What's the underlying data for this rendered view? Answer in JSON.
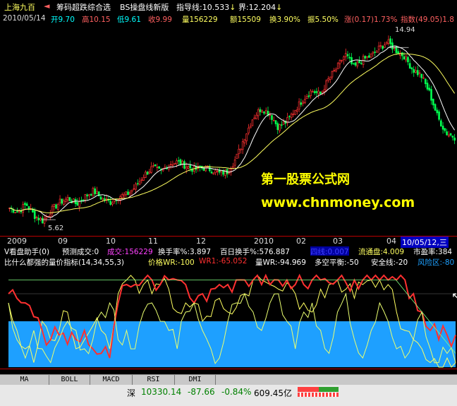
{
  "header": {
    "stock_name": "上海九百",
    "formula_name": "筹码超跌综合选",
    "bs_name": "BS操盘线新版",
    "guide_label": "指导线:",
    "guide_value": "10.533",
    "bound_label": "界:",
    "bound_value": "12.204",
    "arrow_down": "↓"
  },
  "quote": {
    "date": "2010/05/14",
    "open": "开9.70",
    "high": "高10.15",
    "low": "低9.61",
    "close": "收9.99",
    "volume": "量156229",
    "amount": "额15509",
    "turnover": "换3.90%",
    "amplitude": "振5.50%",
    "change": "涨(0.17)1.73%",
    "index": "指数(49.05)1.8"
  },
  "price_labels": {
    "high_mark": "14.94",
    "low_mark": "5.62"
  },
  "date_axis": [
    "2009",
    "09",
    "10",
    "11",
    "12",
    "2010",
    "02",
    "03",
    "04",
    "10/05/12,三"
  ],
  "panel1": {
    "name": "V看盘助手(0)",
    "predict": "预测成交:0",
    "volume": "成交:156229",
    "turnover_rate": "换手率%:3.897",
    "hundred_turnover": "百日换手%:576.887",
    "hidden": "四线:0.007",
    "float_cap": "流通盘:4.009",
    "pe": "市盈率:384"
  },
  "panel2": {
    "name": "比什么都强的量价指标(14,34,55,3)",
    "price_wr": "价格WR:-100",
    "wr1": "WR1:-65.052",
    "vol_wr": "量WR:-94.969",
    "balance": "多空平衡:-50",
    "safety": "安全线:-20",
    "risk": "风险区:-80"
  },
  "watermark": {
    "line1": "第一股票公式网",
    "line2": "www.chnmoney.com"
  },
  "tabs": [
    "MA",
    "BOLL",
    "MACD",
    "RSI",
    "DMI"
  ],
  "status": {
    "market": "深",
    "index_value": "10330.14",
    "change": "-87.66",
    "change_pct": "-0.84%",
    "amount": "609.45亿"
  },
  "colors": {
    "up": "#ff3030",
    "down": "#00ff50",
    "ma_yellow": "#ffff60",
    "ma_white": "#ffffff",
    "blue_band": "#1ea0ff",
    "cyan": "#00ffff",
    "magenta": "#ff40ff"
  },
  "chart_data": [
    {
      "type": "candlestick",
      "title": "上海九百",
      "x_range": [
        "2009-07",
        "2010-05-14"
      ],
      "ylim": [
        5.0,
        15.5
      ],
      "key_prices": {
        "low": 5.62,
        "high": 14.94,
        "last_close": 9.99
      },
      "price_path": [
        6.3,
        6.1,
        6.5,
        5.9,
        5.62,
        6.2,
        6.6,
        6.8,
        6.5,
        6.9,
        7.2,
        6.8,
        6.6,
        6.9,
        7.0,
        7.4,
        8.0,
        8.4,
        8.2,
        8.6,
        8.7,
        8.5,
        8.3,
        8.4,
        8.3,
        8.1,
        8.2,
        8.9,
        10.0,
        11.0,
        11.5,
        11.2,
        10.5,
        10.8,
        11.4,
        12.0,
        12.4,
        12.2,
        13.0,
        13.6,
        14.3,
        13.6,
        14.0,
        14.2,
        14.6,
        14.94,
        14.5,
        14.2,
        13.5,
        13.2,
        12.3,
        11.0,
        10.2,
        9.99
      ]
    },
    {
      "type": "line",
      "title": "比什么都强的量价指标",
      "ylim": [
        -100,
        0
      ],
      "series": [
        {
          "name": "价格WR",
          "values": [
            -30,
            -60,
            -80,
            -95,
            -50,
            -70,
            -60,
            -40,
            -80,
            -70,
            -55,
            -60,
            -80,
            -20,
            -5,
            -5,
            -10,
            -20,
            -10,
            -15,
            -40,
            -30,
            -30,
            -50,
            -45,
            -25,
            -40,
            -35,
            -20,
            -5,
            -5,
            -10,
            -15,
            -8,
            -20,
            -30,
            -40,
            -15,
            -10,
            -5,
            -15,
            -25,
            -10,
            -5,
            -5,
            -10,
            -40,
            -60,
            -70,
            -80,
            -95,
            -100,
            -90,
            -95
          ]
        },
        {
          "name": "WR1",
          "values": [
            -20,
            -25,
            -30,
            -45,
            -60,
            -70,
            -65,
            -75,
            -70,
            -60,
            -80,
            -85,
            -90,
            -30,
            -10,
            -10,
            -5,
            -5,
            -10,
            -5,
            -5,
            -10,
            -30,
            -20,
            -15,
            -10,
            -10,
            -5,
            -5,
            -5,
            -10,
            -10,
            -5,
            -5,
            -10,
            -10,
            -5,
            -5,
            -8,
            -5,
            -8,
            -5,
            -5,
            -5,
            -5,
            -5,
            -5,
            -5,
            -20,
            -40,
            -60,
            -70,
            -65,
            -65
          ]
        },
        {
          "name": "量WR",
          "values": [
            -30,
            -70,
            -90,
            -60,
            -80,
            -95,
            -70,
            -50,
            -60,
            -80,
            -70,
            -40,
            -30,
            -70,
            -60,
            -80,
            -40,
            -30,
            -50,
            -60,
            -80,
            -40,
            -30,
            -60,
            -80,
            -90,
            -50,
            -30,
            -20,
            -40,
            -60,
            -30,
            -20,
            -50,
            -80,
            -40,
            -30,
            -60,
            -85,
            -40,
            -20,
            -70,
            -90,
            -60,
            -30,
            -50,
            -80,
            -90,
            -70,
            -40,
            -80,
            -95,
            -85,
            -95
          ]
        }
      ],
      "bands": {
        "safety": -20,
        "risk": -80
      }
    }
  ]
}
